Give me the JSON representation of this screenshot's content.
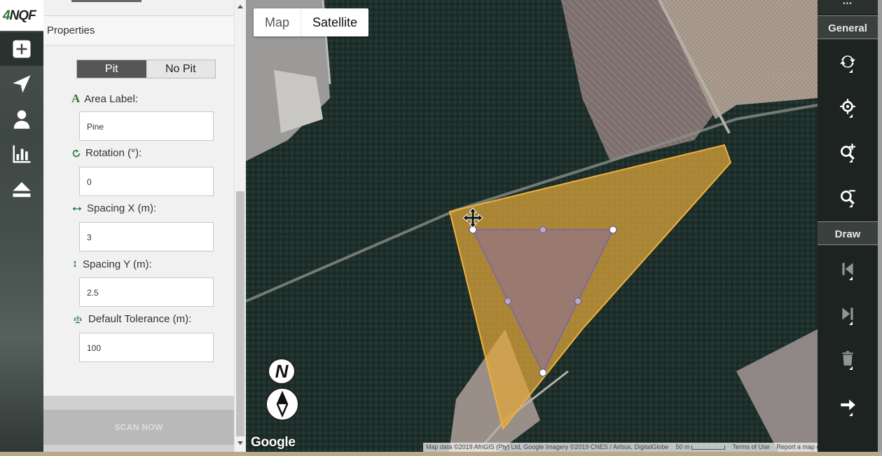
{
  "app": {
    "logo_text": "NQF",
    "logo_prefix": "4"
  },
  "rail": {
    "items": [
      {
        "icon": "plus-square-icon",
        "active": true
      },
      {
        "icon": "navigate-arrow-icon"
      },
      {
        "icon": "user-icon"
      },
      {
        "icon": "bar-chart-icon"
      },
      {
        "icon": "eject-icon"
      }
    ]
  },
  "panel": {
    "title": "Properties",
    "toggle": {
      "left_label": "Pit",
      "right_label": "No Pit",
      "selected": "Pit"
    },
    "fields": [
      {
        "label": "Area Label:",
        "value": "Pine",
        "icon": "font-a-icon"
      },
      {
        "label": "Rotation (°):",
        "value": "0",
        "icon": "refresh-icon"
      },
      {
        "label": "Spacing X (m):",
        "value": "3",
        "icon": "horizontal-arrows-icon"
      },
      {
        "label": "Spacing Y (m):",
        "value": "2.5",
        "icon": "vertical-arrows-icon"
      },
      {
        "label": "Default Tolerance (m):",
        "value": "100",
        "icon": "scale-balance-icon"
      }
    ],
    "scan_button": "SCAN NOW"
  },
  "map": {
    "type_buttons": [
      "Map",
      "Satellite"
    ],
    "selected_type": "Satellite",
    "compass_label": "N",
    "google_logo": "Google",
    "attribution": "Map data ©2019 AfriGIS (Pty) Ltd, Google Imagery ©2019 CNES / Airbus, DigitalGlobe",
    "scale_label": "50 m",
    "terms": "Terms of Use",
    "report": "Report a map error",
    "colors": {
      "polygon_fill": "#e0a83a",
      "polygon_stroke": "#f0b03c",
      "triangle_fill": "#8a6fa0",
      "triangle_stroke": "#7a64a8"
    }
  },
  "tools": {
    "dots": "•••",
    "general_label": "General",
    "draw_label": "Draw",
    "general_items": [
      "refresh-icon",
      "locate-crosshair-icon",
      "zoom-in-icon",
      "zoom-out-icon"
    ],
    "draw_items": [
      "skip-back-icon",
      "skip-forward-icon",
      "trash-icon",
      "arrow-right-icon"
    ]
  }
}
